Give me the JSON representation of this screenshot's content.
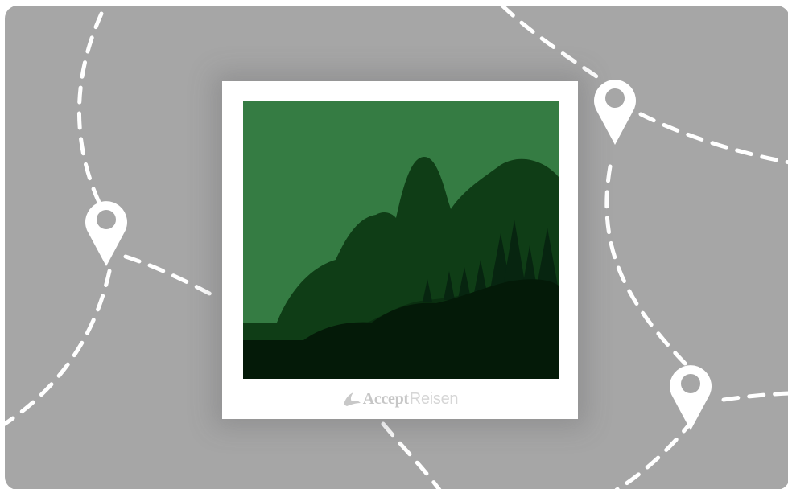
{
  "brand": {
    "icon": "leaf-logo-icon",
    "word_1": "Accept",
    "word_2": "Reisen"
  },
  "colors": {
    "background": "#a6a6a6",
    "route_line": "#ffffff",
    "pin": "#ffffff",
    "sky": "#357c43",
    "far_hills": "#0f3d16",
    "mid_hills": "#0a2f10",
    "foreground": "#041a08"
  },
  "icons": [
    "location-pin-icon",
    "leaf-logo-icon"
  ]
}
